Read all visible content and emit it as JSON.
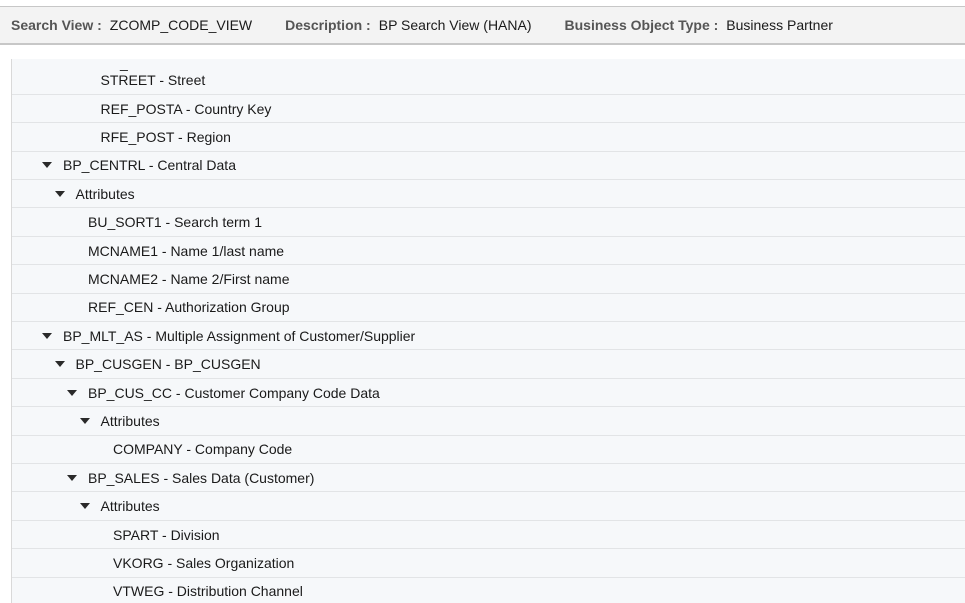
{
  "header": {
    "search_view_label": "Search View :",
    "search_view_value": "ZCOMP_CODE_VIEW",
    "description_label": "Description :",
    "description_value": "BP Search View (HANA)",
    "bo_type_label": "Business Object Type :",
    "bo_type_value": "Business Partner"
  },
  "tree": {
    "top_fragment": "_",
    "nodes": [
      {
        "label": "STREET - Street",
        "expandable": false,
        "level": 4
      },
      {
        "label": "REF_POSTA - Country Key",
        "expandable": false,
        "level": 4
      },
      {
        "label": "RFE_POST - Region",
        "expandable": false,
        "level": 4
      },
      {
        "label": "BP_CENTRL - Central Data",
        "expandable": true,
        "level": 0
      },
      {
        "label": "Attributes",
        "expandable": true,
        "level": 1
      },
      {
        "label": "BU_SORT1 - Search term 1",
        "expandable": false,
        "level": 3
      },
      {
        "label": "MCNAME1 - Name 1/last name",
        "expandable": false,
        "level": 3
      },
      {
        "label": "MCNAME2 - Name 2/First name",
        "expandable": false,
        "level": 3
      },
      {
        "label": "REF_CEN - Authorization Group",
        "expandable": false,
        "level": 3
      },
      {
        "label": "BP_MLT_AS - Multiple Assignment of Customer/Supplier",
        "expandable": true,
        "level": 0
      },
      {
        "label": "BP_CUSGEN - BP_CUSGEN",
        "expandable": true,
        "level": 1
      },
      {
        "label": "BP_CUS_CC - Customer Company Code Data",
        "expandable": true,
        "level": 2
      },
      {
        "label": "Attributes",
        "expandable": true,
        "level": 3
      },
      {
        "label": "COMPANY - Company Code",
        "expandable": false,
        "level": 5
      },
      {
        "label": "BP_SALES - Sales Data (Customer)",
        "expandable": true,
        "level": 2
      },
      {
        "label": "Attributes",
        "expandable": true,
        "level": 3
      },
      {
        "label": "SPART - Division",
        "expandable": false,
        "level": 5
      },
      {
        "label": "VKORG - Sales Organization",
        "expandable": false,
        "level": 5
      },
      {
        "label": "VTWEG - Distribution Channel",
        "expandable": false,
        "level": 5
      }
    ]
  }
}
